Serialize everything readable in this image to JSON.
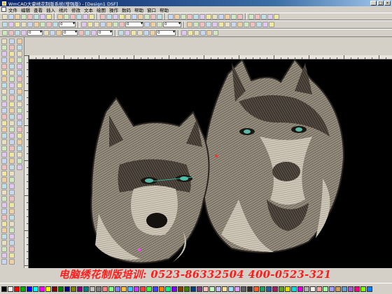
{
  "window": {
    "title": "WmCAD大豪绣花制版系统(增强版) - [Design1 DSF]",
    "buttons": [
      "_",
      "□",
      "×"
    ]
  },
  "menu": {
    "items": [
      "文件",
      "编辑",
      "查看",
      "插入",
      "绣片",
      "修改",
      "文本",
      "绘图",
      "操作",
      "数码",
      "帮助",
      "窗口",
      "帮助"
    ]
  },
  "toolbar2": {
    "field_1": "0",
    "field_2": "0",
    "field_3": "0"
  },
  "toolbar3": {
    "field_1": "0",
    "field_2": "0",
    "field_3": "0",
    "field_4": "0"
  },
  "banner": {
    "text": "电脑绣花制版培训:  0523-86332504  400-0523-321",
    "color": "#ff1b1b"
  },
  "palette": {
    "colors": [
      "#000000",
      "#ffffff",
      "#ff0000",
      "#00b000",
      "#0000ff",
      "#00ffff",
      "#ff00ff",
      "#ffff00",
      "#800000",
      "#008000",
      "#000080",
      "#808000",
      "#800080",
      "#008080",
      "#c0c0c0",
      "#808080",
      "#ff8080",
      "#80ff80",
      "#8080ff",
      "#ffc040",
      "#40c0ff",
      "#c040ff",
      "#ff4040",
      "#40ff40",
      "#4040ff",
      "#ff8000",
      "#00ff80",
      "#8000ff",
      "#804000",
      "#408000",
      "#004080",
      "#804080",
      "#ffc0c0",
      "#c0ffc0",
      "#c0c0ff",
      "#ffe0a0",
      "#a0e0ff",
      "#e0a0ff",
      "#606060",
      "#303030",
      "#ff6020",
      "#20a060",
      "#2060a0",
      "#a02060",
      "#60a020",
      "#e0e000",
      "#00e0e0",
      "#e000e0",
      "#b0b0b0",
      "#f0f0f0",
      "#ffa0a0",
      "#a0ffa0",
      "#a0a0ff",
      "#d0a060",
      "#60a0d0",
      "#a060d0",
      "#ff0080",
      "#80ff00",
      "#0080ff"
    ]
  },
  "canvas": {
    "background": "#000000",
    "description_icons": [
      "wolf-embroidery-left",
      "wolf-embroidery-right"
    ]
  }
}
